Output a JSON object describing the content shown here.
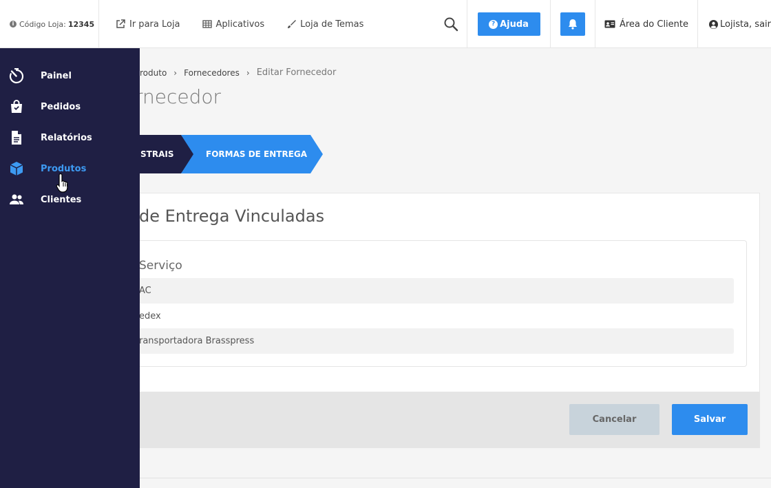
{
  "topbar": {
    "store_code_label": "Código Loja:",
    "store_code_value": "12345",
    "links": [
      {
        "label": "Ir para Loja",
        "icon": "external-link-icon"
      },
      {
        "label": "Aplicativos",
        "icon": "grid-icon"
      },
      {
        "label": "Loja de Temas",
        "icon": "brush-icon"
      }
    ],
    "help_label": "Ajuda",
    "client_area_label": "Área do Cliente",
    "logout_label": "Lojista, sair"
  },
  "sidebar": {
    "items": [
      {
        "label": "Painel",
        "icon": "stopwatch-icon"
      },
      {
        "label": "Pedidos",
        "icon": "shopping-bag-icon"
      },
      {
        "label": "Relatórios",
        "icon": "document-icon"
      },
      {
        "label": "Produtos",
        "icon": "box-icon",
        "active": true
      },
      {
        "label": "Clientes",
        "icon": "users-icon"
      }
    ]
  },
  "breadcrumb": {
    "items": [
      "roduto",
      "Fornecedores"
    ],
    "current": "Editar Fornecedor"
  },
  "page": {
    "title": "rnecedor"
  },
  "steps": {
    "first": "STRAIS",
    "second": "FORMAS DE ENTREGA"
  },
  "card": {
    "title": "de Entrega Vinculadas",
    "column_header": "Serviço",
    "rows": [
      "AC",
      "edex",
      "ransportadora Brasspress"
    ],
    "cancel_label": "Cancelar",
    "save_label": "Salvar"
  },
  "colors": {
    "sidebar_bg": "#1f1f44",
    "accent": "#2d8cee",
    "active_link": "#3d9af2"
  }
}
